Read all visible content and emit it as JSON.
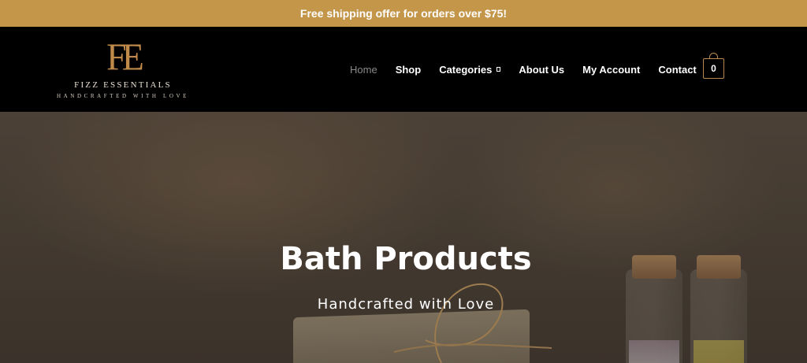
{
  "announcement": {
    "text": "Free shipping offer for orders over $75!"
  },
  "brand": {
    "monogram": "FE",
    "name": "FIZZ ESSENTIALS",
    "tagline": "HANDCRAFTED WITH LOVE"
  },
  "nav": {
    "items": [
      {
        "label": "Home",
        "active": true
      },
      {
        "label": "Shop"
      },
      {
        "label": "Categories",
        "has_dropdown": true
      },
      {
        "label": "About Us"
      },
      {
        "label": "My Account"
      },
      {
        "label": "Contact"
      }
    ]
  },
  "cart": {
    "count": "0",
    "icon": "shopping-bag-icon"
  },
  "hero": {
    "title": "Bath Products",
    "subtitle": "Handcrafted with Love"
  },
  "colors": {
    "announcement_bg": "#c4964a",
    "header_bg": "#000000",
    "accent": "#c08a4a"
  }
}
